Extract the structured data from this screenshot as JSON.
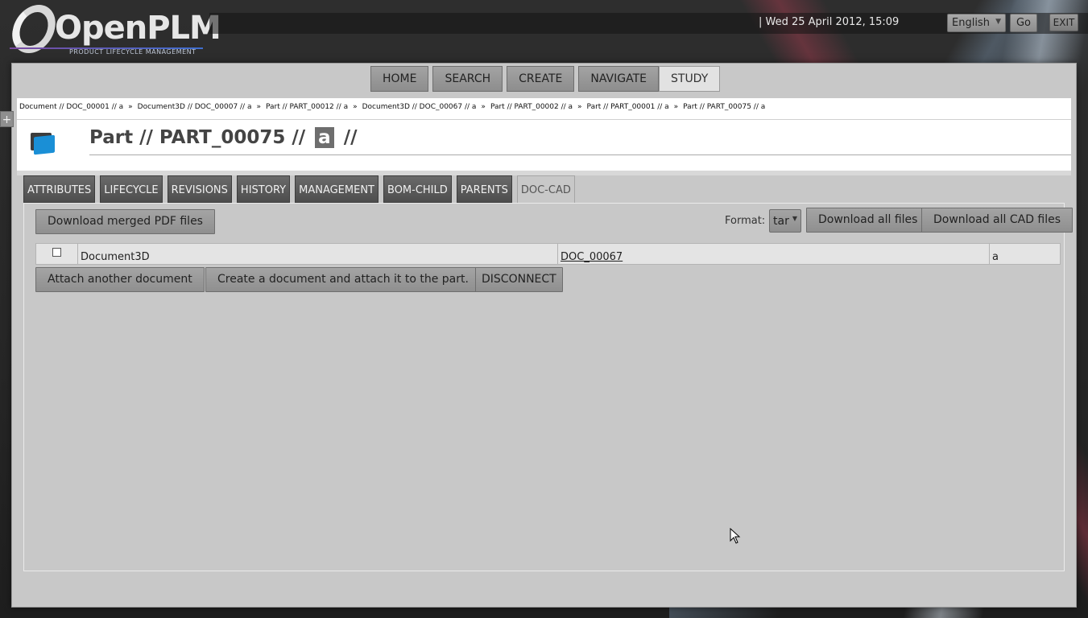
{
  "header": {
    "logo_text": "OpenPLM",
    "tagline": "PRODUCT LIFECYCLE MANAGEMENT",
    "datetime": "| Wed 25 April 2012, 15:09",
    "language": "English",
    "go_label": "Go",
    "exit_label": "EXIT"
  },
  "nav": {
    "items": [
      "HOME",
      "SEARCH",
      "CREATE",
      "NAVIGATE",
      "STUDY"
    ],
    "active": "STUDY"
  },
  "side_toggle": "+",
  "breadcrumb": [
    "Document // DOC_00001 // a",
    "Document3D // DOC_00007 // a",
    "Part // PART_00012 // a",
    "Document3D // DOC_00067 // a",
    "Part // PART_00002 // a",
    "Part // PART_00001 // a",
    "Part // PART_00075 // a"
  ],
  "breadcrumb_separator": "»",
  "object": {
    "title_prefix": "Part // PART_00075 //",
    "revision": "a",
    "title_suffix": "//"
  },
  "tabs": [
    "ATTRIBUTES",
    "LIFECYCLE",
    "REVISIONS",
    "HISTORY",
    "MANAGEMENT",
    "BOM-CHILD",
    "PARENTS",
    "DOC-CAD"
  ],
  "active_tab": "DOC-CAD",
  "doc_cad": {
    "download_pdf_label": "Download merged PDF files",
    "format_label": "Format:",
    "format_value": "tar",
    "download_all_label": "Download all files",
    "download_cad_label": "Download all CAD files",
    "rows": [
      {
        "type": "Document3D",
        "reference": "DOC_00067",
        "revision": "a"
      }
    ],
    "attach_label": "Attach another document",
    "create_attach_label": "Create a document and attach it to the part.",
    "disconnect_label": "DISCONNECT"
  },
  "colors": {
    "accent_blue": "#1a8fd6",
    "panel_gray": "#c8c8c8",
    "header_dark": "#2e2e2e"
  }
}
